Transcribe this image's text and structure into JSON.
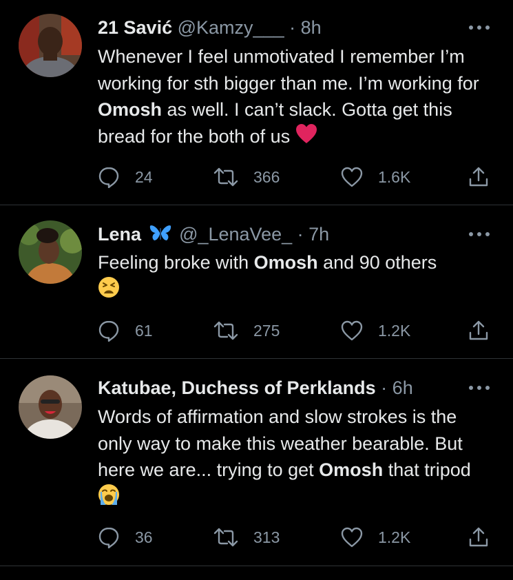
{
  "tweets": [
    {
      "name": "21 Savić",
      "handle": "@Kamzy___",
      "dot": "·",
      "time": "8h",
      "text_parts": [
        "Whenever I feel unmotivated I remember I’m working for sth bigger than me. I’m working for ",
        "Omosh",
        " as well. I can’t slack. Gotta get this bread for the both of us"
      ],
      "emoji": "red-heart",
      "replies": "24",
      "retweets": "366",
      "likes": "1.6K"
    },
    {
      "name": "Lena",
      "name_emoji": "butterfly",
      "handle": "@_LenaVee_",
      "dot": "·",
      "time": "7h",
      "text_parts": [
        "Feeling broke with ",
        "Omosh",
        " and 90 others"
      ],
      "emoji": "tired-face",
      "replies": "61",
      "retweets": "275",
      "likes": "1.2K"
    },
    {
      "name": "Katubae, Duchess of Perklands",
      "handle": "",
      "dot": "·",
      "time": "6h",
      "text_parts": [
        "Words of affirmation and slow strokes is the only way to make this weather bearable. But here we are... trying to get ",
        "Omosh",
        " that tripod"
      ],
      "emoji": "loudly-crying-face",
      "replies": "36",
      "retweets": "313",
      "likes": "1.2K"
    }
  ],
  "colors": {
    "background": "#000000",
    "text": "#e7e9ea",
    "secondary": "#8b98a5",
    "divider": "#2f3336",
    "heart": "#e0245e",
    "butterfly": "#3fa0ff"
  },
  "icons": [
    "reply-icon",
    "retweet-icon",
    "like-icon",
    "share-icon",
    "more-icon"
  ]
}
